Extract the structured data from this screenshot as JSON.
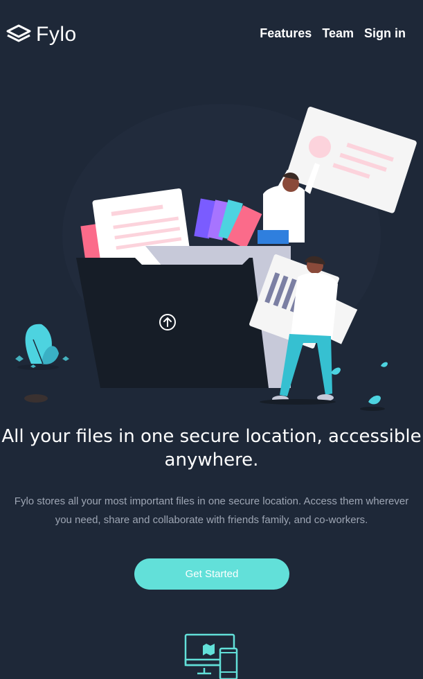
{
  "header": {
    "brand": "Fylo",
    "nav": [
      "Features",
      "Team",
      "Sign in"
    ]
  },
  "hero": {
    "headline": "All your files in one secure location, accessible anywhere.",
    "subtext": "Fylo stores all your most important files in one secure location. Access them wherever you need, share and collaborate with friends family, and co-workers.",
    "cta_label": "Get Started"
  },
  "colors": {
    "background": "#1e2838",
    "accent": "#62e0d9",
    "text_muted": "#9ea6b4"
  },
  "icons": {
    "logo": "stacked-layers-icon",
    "upload": "upload-arrow-icon",
    "feature": "access-anywhere-devices-icon"
  }
}
